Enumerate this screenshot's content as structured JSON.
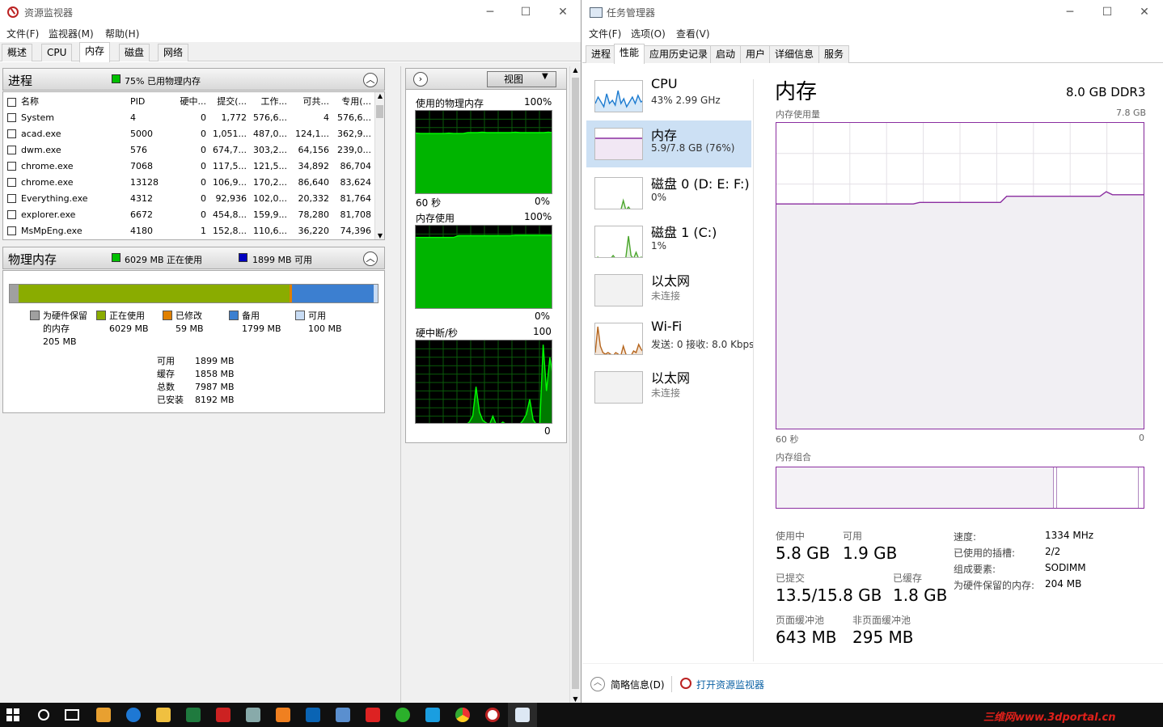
{
  "resmon": {
    "title": "资源监视器",
    "menus": [
      "文件(F)",
      "监视器(M)",
      "帮助(H)"
    ],
    "tabs": [
      "概述",
      "CPU",
      "内存",
      "磁盘",
      "网络"
    ],
    "proc_section": {
      "title": "进程",
      "indicator": "75% 已用物理内存",
      "indicator_color": "#00c000"
    },
    "proc_headers": [
      "名称",
      "PID",
      "硬中...",
      "提交(...",
      "工作...",
      "可共...",
      "专用(..."
    ],
    "proc_rows": [
      [
        "System",
        "4",
        "0",
        "1,772",
        "576,6...",
        "4",
        "576,6..."
      ],
      [
        "acad.exe",
        "5000",
        "0",
        "1,051...",
        "487,0...",
        "124,1...",
        "362,9..."
      ],
      [
        "dwm.exe",
        "576",
        "0",
        "674,7...",
        "303,2...",
        "64,156",
        "239,0..."
      ],
      [
        "chrome.exe",
        "7068",
        "0",
        "117,5...",
        "121,5...",
        "34,892",
        "86,704"
      ],
      [
        "chrome.exe",
        "13128",
        "0",
        "106,9...",
        "170,2...",
        "86,640",
        "83,624"
      ],
      [
        "Everything.exe",
        "4312",
        "0",
        "92,936",
        "102,0...",
        "20,332",
        "81,764"
      ],
      [
        "explorer.exe",
        "6672",
        "0",
        "454,8...",
        "159,9...",
        "78,280",
        "81,708"
      ],
      [
        "MsMpEng.exe",
        "4180",
        "1",
        "152,8...",
        "110,6...",
        "36,220",
        "74,396"
      ]
    ],
    "phys_section": {
      "title": "物理内存",
      "in_use": "6029 MB 正在使用",
      "available": "1899 MB 可用",
      "in_use_color": "#00c000",
      "available_color": "#0000c0"
    },
    "bar_fractions": {
      "hardware": 0.025,
      "in_use": 0.736,
      "modified": 0.007,
      "standby": 0.22,
      "free": 0.012
    },
    "legend": [
      {
        "label": "为硬件保留的内存",
        "line1": "为硬件保留",
        "line2": "的内存",
        "value": "205 MB",
        "color": "#a0a0a0"
      },
      {
        "label": "正在使用",
        "value": "6029 MB",
        "color": "#8aac00"
      },
      {
        "label": "已修改",
        "value": "59 MB",
        "color": "#e08000"
      },
      {
        "label": "备用",
        "value": "1799 MB",
        "color": "#3c7fd0"
      },
      {
        "label": "可用",
        "value": "100 MB",
        "color": "#c8dcf4"
      }
    ],
    "summary": [
      {
        "k": "可用",
        "v": "1899 MB"
      },
      {
        "k": "缓存",
        "v": "1858 MB"
      },
      {
        "k": "总数",
        "v": "7987 MB"
      },
      {
        "k": "已安装",
        "v": "8192 MB"
      }
    ],
    "view_button": "视图",
    "graphs": [
      {
        "title": "使用的物理内存",
        "max": "100%",
        "min": "0%",
        "time": "60 秒"
      },
      {
        "title": "内存使用",
        "max": "100%",
        "min": "0%"
      },
      {
        "title": "硬中断/秒",
        "max": "100",
        "min": "0"
      }
    ]
  },
  "taskmgr": {
    "title": "任务管理器",
    "menus": [
      "文件(F)",
      "选项(O)",
      "查看(V)"
    ],
    "tabs": [
      "进程",
      "性能",
      "应用历史记录",
      "启动",
      "用户",
      "详细信息",
      "服务"
    ],
    "sidebar": [
      {
        "name": "CPU",
        "sub": "43%  2.99 GHz",
        "color": "#1c7bd0"
      },
      {
        "name": "内存",
        "sub": "5.9/7.8 GB (76%)",
        "color": "#8b2ea0"
      },
      {
        "name": "磁盘 0 (D: E: F:)",
        "sub": "0%",
        "color": "#4aa52c"
      },
      {
        "name": "磁盘 1 (C:)",
        "sub": "1%",
        "color": "#4aa52c"
      },
      {
        "name": "以太网",
        "sub": "未连接",
        "color": "#bbbbbb"
      },
      {
        "name": "Wi-Fi",
        "sub": "发送: 0 接收: 8.0 Kbps",
        "color": "#b5651d"
      },
      {
        "name": "以太网",
        "sub": "未连接",
        "color": "#bbbbbb"
      }
    ],
    "main": {
      "title": "内存",
      "spec": "8.0 GB DDR3",
      "usage_label": "内存使用量",
      "usage_max": "7.8 GB",
      "time_left": "60 秒",
      "time_right": "0",
      "composition_label": "内存组合",
      "stats": [
        {
          "k": "使用中",
          "v": "5.8 GB"
        },
        {
          "k": "可用",
          "v": "1.9 GB"
        },
        {
          "k": "已提交",
          "v": "13.5/15.8 GB"
        },
        {
          "k": "已缓存",
          "v": "1.8 GB"
        },
        {
          "k": "页面缓冲池",
          "v": "643 MB"
        },
        {
          "k": "非页面缓冲池",
          "v": "295 MB"
        }
      ],
      "props": [
        {
          "k": "速度:",
          "v": "1334 MHz"
        },
        {
          "k": "已使用的插槽:",
          "v": "2/2"
        },
        {
          "k": "组成要素:",
          "v": "SODIMM"
        },
        {
          "k": "为硬件保留的内存:",
          "v": "204 MB"
        }
      ]
    },
    "footer": {
      "brief": "简略信息(D)",
      "open_resmon": "打开资源监视器"
    }
  },
  "watermark": "三维网www.3dportal.cn"
}
